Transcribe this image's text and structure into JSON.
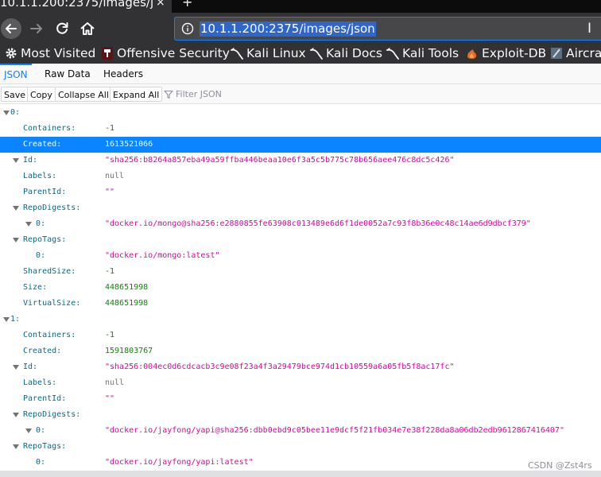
{
  "browser": {
    "tab_title": "10.1.1.200:2375/images/j",
    "tab_close": "×",
    "new_tab": "+",
    "url": "10.1.1.200:2375/images/json"
  },
  "bookmarks": [
    {
      "label": "Most Visited",
      "icon": "gear-icon"
    },
    {
      "label": "Offensive Security",
      "icon": "offsec-icon"
    },
    {
      "label": "Kali Linux",
      "icon": "kali-dragon-icon"
    },
    {
      "label": "Kali Docs",
      "icon": "kali-dragon-icon"
    },
    {
      "label": "Kali Tools",
      "icon": "kali-dragon-icon"
    },
    {
      "label": "Exploit-DB",
      "icon": "exploit-db-icon"
    },
    {
      "label": "Aircrac",
      "icon": "aircrack-icon"
    }
  ],
  "viewer_tabs": [
    "JSON",
    "Raw Data",
    "Headers"
  ],
  "actions": [
    "Save",
    "Copy",
    "Collapse All",
    "Expand All"
  ],
  "filter_placeholder": "Filter JSON",
  "colors": {
    "accent": "#0a84ff",
    "string": "#dd00a9",
    "number": "#058b00",
    "key": "#006d8b"
  },
  "rows": [
    {
      "depth": 0,
      "twisty": true,
      "key": "0:",
      "value": "",
      "type": ""
    },
    {
      "depth": 1,
      "twisty": false,
      "key": "Containers:",
      "value": "-1",
      "type": "num"
    },
    {
      "depth": 1,
      "twisty": false,
      "key": "Created:",
      "value": "1613521066",
      "type": "num",
      "selected": true
    },
    {
      "depth": 1,
      "twisty": true,
      "key": "Id:",
      "value": "\"sha256:b8264a857eba49a59ffba446beaa10e6f3a5c5b775c78b656aee476c8dc5c426\"",
      "type": "str"
    },
    {
      "depth": 1,
      "twisty": false,
      "key": "Labels:",
      "value": "null",
      "type": "nul"
    },
    {
      "depth": 1,
      "twisty": false,
      "key": "ParentId:",
      "value": "\"\"",
      "type": "str"
    },
    {
      "depth": 1,
      "twisty": true,
      "key": "RepoDigests:",
      "value": "",
      "type": ""
    },
    {
      "depth": 2,
      "twisty": true,
      "key": "0:",
      "value": "\"docker.io/mongo@sha256:e2880855fe63908c013489e6d6f1de0052a7c93f8b36e0c48c14ae6d9dbcf379\"",
      "type": "str"
    },
    {
      "depth": 1,
      "twisty": true,
      "key": "RepoTags:",
      "value": "",
      "type": ""
    },
    {
      "depth": 2,
      "twisty": false,
      "key": "0:",
      "value": "\"docker.io/mongo:latest\"",
      "type": "str"
    },
    {
      "depth": 1,
      "twisty": false,
      "key": "SharedSize:",
      "value": "-1",
      "type": "num"
    },
    {
      "depth": 1,
      "twisty": false,
      "key": "Size:",
      "value": "448651998",
      "type": "num"
    },
    {
      "depth": 1,
      "twisty": false,
      "key": "VirtualSize:",
      "value": "448651998",
      "type": "num"
    },
    {
      "depth": 0,
      "twisty": true,
      "key": "1:",
      "value": "",
      "type": ""
    },
    {
      "depth": 1,
      "twisty": false,
      "key": "Containers:",
      "value": "-1",
      "type": "num"
    },
    {
      "depth": 1,
      "twisty": false,
      "key": "Created:",
      "value": "1591803767",
      "type": "num"
    },
    {
      "depth": 1,
      "twisty": true,
      "key": "Id:",
      "value": "\"sha256:004ec0d6cdcacb3c9e08f23a4f3a29479bce974d1cb10559a6a05fb5f8ac17fc\"",
      "type": "str"
    },
    {
      "depth": 1,
      "twisty": false,
      "key": "Labels:",
      "value": "null",
      "type": "nul"
    },
    {
      "depth": 1,
      "twisty": false,
      "key": "ParentId:",
      "value": "\"\"",
      "type": "str"
    },
    {
      "depth": 1,
      "twisty": true,
      "key": "RepoDigests:",
      "value": "",
      "type": ""
    },
    {
      "depth": 2,
      "twisty": true,
      "key": "0:",
      "value": "\"docker.io/jayfong/yapi@sha256:dbb0ebd9c05bee11e9dcf5f21fb034e7e38f228da8a06db2edb9612867416407\"",
      "type": "str"
    },
    {
      "depth": 1,
      "twisty": true,
      "key": "RepoTags:",
      "value": "",
      "type": ""
    },
    {
      "depth": 2,
      "twisty": false,
      "key": "0:",
      "value": "\"docker.io/jayfong/yapi:latest\"",
      "type": "str"
    }
  ],
  "watermark": "CSDN @Zst4rs"
}
